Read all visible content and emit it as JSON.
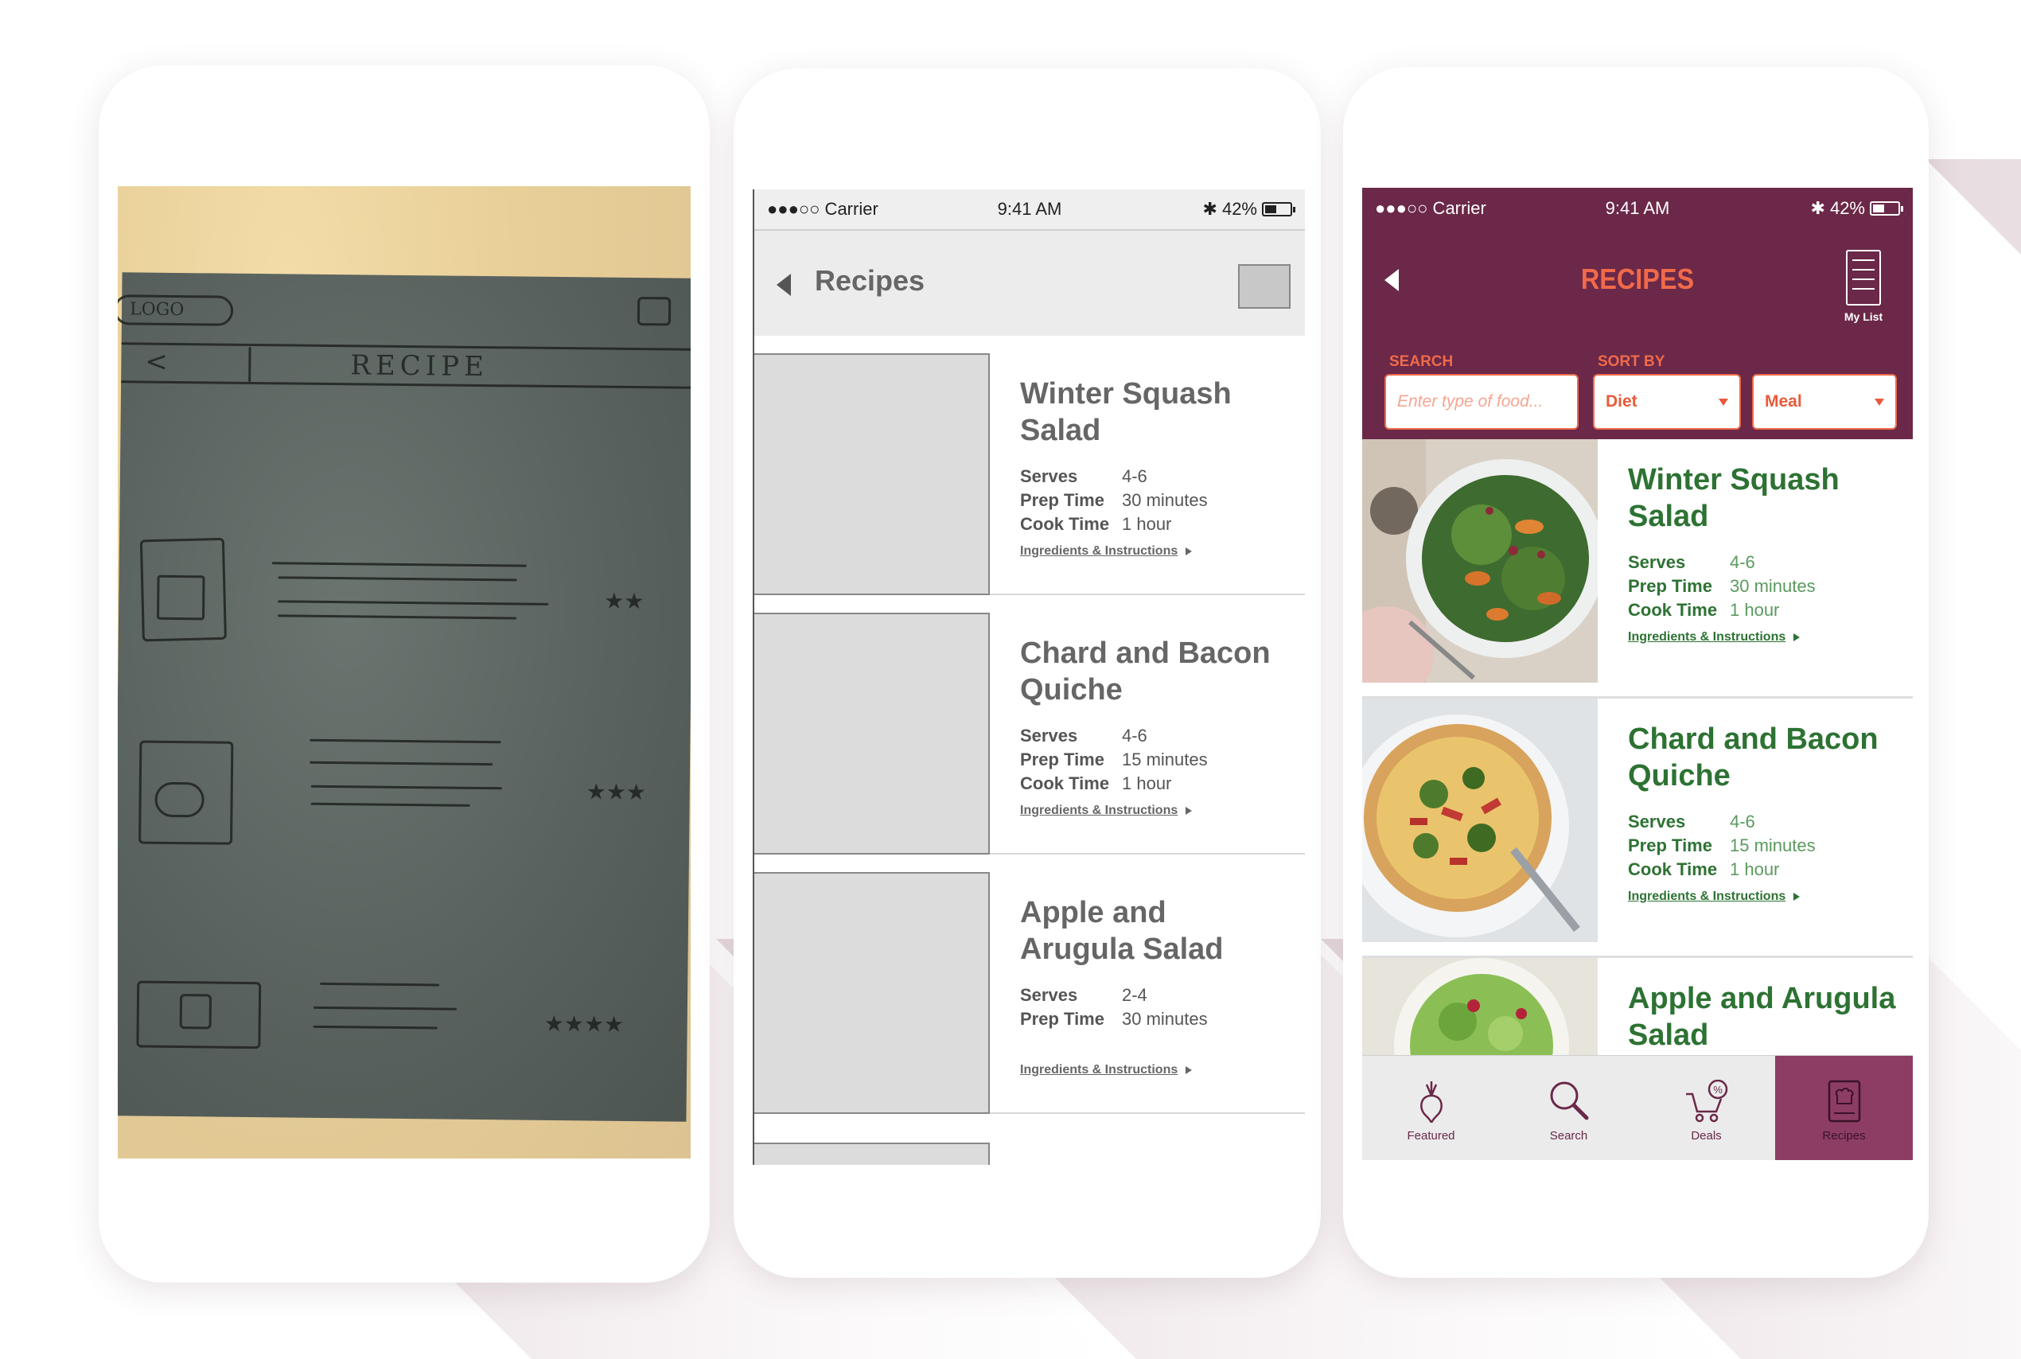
{
  "sketch": {
    "logo": "LOGO",
    "title": "RECIPE"
  },
  "wireframe": {
    "status": {
      "carrier": "●●●○○ Carrier",
      "time": "9:41 AM",
      "battery": "42%"
    },
    "nav_title": "Recipes",
    "link_label": "Ingredients & Instructions",
    "recipes": [
      {
        "name": "Winter Squash Salad",
        "serves_label": "Serves",
        "serves": "4-6",
        "prep_label": "Prep Time",
        "prep": "30 minutes",
        "cook_label": "Cook Time",
        "cook": "1 hour"
      },
      {
        "name": "Chard and Bacon Quiche",
        "serves_label": "Serves",
        "serves": "4-6",
        "prep_label": "Prep Time",
        "prep": "15 minutes",
        "cook_label": "Cook Time",
        "cook": "1 hour"
      },
      {
        "name": "Apple and Arugula Salad",
        "serves_label": "Serves",
        "serves": "2-4",
        "prep_label": "Prep Time",
        "prep": "30 minutes"
      }
    ]
  },
  "final": {
    "status": {
      "carrier": "●●●○○ Carrier",
      "time": "9:41 AM",
      "battery": "42%"
    },
    "nav_title": "RECIPES",
    "my_list": "My List",
    "search_label": "SEARCH",
    "sort_label": "SORT BY",
    "search_placeholder": "Enter type of food...",
    "diet": "Diet",
    "meal": "Meal",
    "link_label": "Ingredients & Instructions",
    "recipes": [
      {
        "name": "Winter Squash Salad",
        "serves_label": "Serves",
        "serves": "4-6",
        "prep_label": "Prep Time",
        "prep": "30 minutes",
        "cook_label": "Cook Time",
        "cook": "1 hour"
      },
      {
        "name": "Chard and Bacon Quiche",
        "serves_label": "Serves",
        "serves": "4-6",
        "prep_label": "Prep Time",
        "prep": "15 minutes",
        "cook_label": "Cook Time",
        "cook": "1 hour"
      },
      {
        "name": "Apple and Arugula Salad"
      }
    ],
    "tabs": [
      {
        "label": "Featured",
        "icon": "beet-icon"
      },
      {
        "label": "Search",
        "icon": "magnifier-icon"
      },
      {
        "label": "Deals",
        "icon": "cart-percent-icon"
      },
      {
        "label": "Recipes",
        "icon": "recipe-book-icon"
      }
    ],
    "colors": {
      "brand": "#6b2848",
      "accent": "#f06a4a",
      "green": "#2d7233",
      "active_tab": "#8d3d64"
    }
  }
}
